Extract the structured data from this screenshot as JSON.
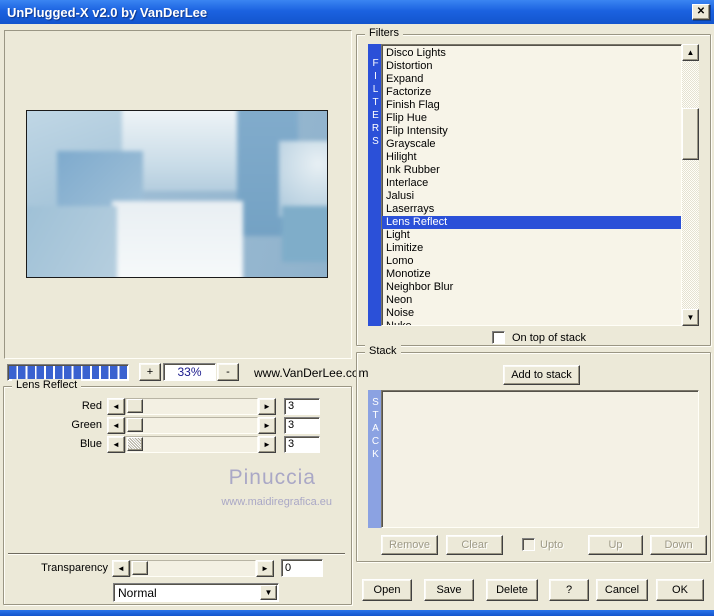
{
  "window": {
    "title": "UnPlugged-X v2.0 by VanDerLee",
    "close": "✕"
  },
  "preview": {
    "zoom_in": "+",
    "zoom_out": "-",
    "zoom_level": "33%",
    "website": "www.VanDerLee.com",
    "watermark": {
      "name": "Pinuccia",
      "url": "www.maidiregrafica.eu"
    }
  },
  "lens_reflect": {
    "group_label": "Lens Reflect",
    "sliders": [
      {
        "label": "Red",
        "value": "3"
      },
      {
        "label": "Green",
        "value": "3"
      },
      {
        "label": "Blue",
        "value": "3"
      }
    ],
    "transparency": {
      "label": "Transparency",
      "value": "0"
    },
    "blend_mode": {
      "selected": "Normal"
    }
  },
  "filters": {
    "group_label": "Filters",
    "side_label": "FILTERS",
    "items": [
      "Disco Lights",
      "Distortion",
      "Expand",
      "Factorize",
      "Finish Flag",
      "Flip Hue",
      "Flip Intensity",
      "Grayscale",
      "Hilight",
      "Ink Rubber",
      "Interlace",
      "Jalusi",
      "Laserrays",
      "Lens Reflect",
      "Light",
      "Limitize",
      "Lomo",
      "Monotize",
      "Neighbor Blur",
      "Neon",
      "Noise",
      "Nuke"
    ],
    "selected_item": "Lens Reflect",
    "on_top_label": "On top of stack"
  },
  "stack": {
    "group_label": "Stack",
    "side_label": "STACK",
    "add_button": "Add to stack",
    "remove_button": "Remove",
    "clear_button": "Clear",
    "upto_label": "Upto",
    "up_button": "Up",
    "down_button": "Down"
  },
  "footer": {
    "buttons": [
      "Open",
      "Save",
      "Delete",
      "?",
      "Cancel",
      "OK"
    ]
  },
  "colors": {
    "titlebar_blue": "#1b62e0",
    "dialog_bg": "#ece9d8",
    "selection_blue": "#2b50d8",
    "stack_bar_blue": "#8ba2e2",
    "progress_blue": "#3a62d0",
    "watermark_gray": "#aaa8c6"
  }
}
